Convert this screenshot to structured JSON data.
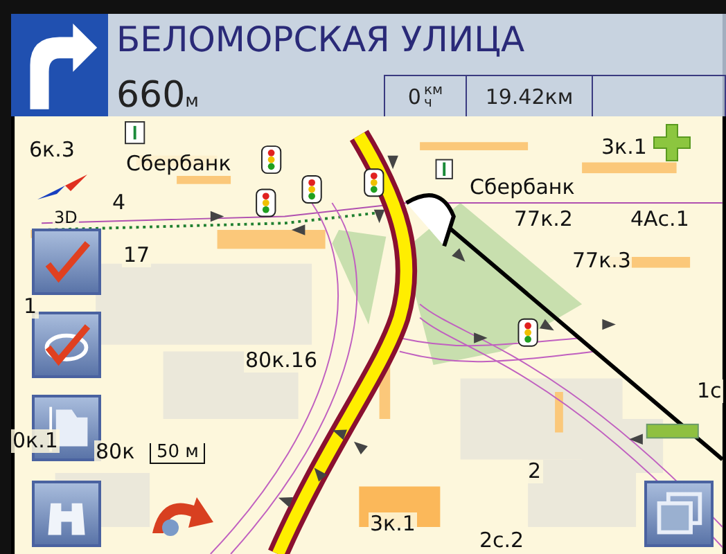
{
  "header": {
    "street": "БЕЛОМОРСКАЯ УЛИЦА",
    "distance": "660",
    "distance_unit": "м",
    "speed": "0",
    "speed_unit_top": "км",
    "speed_unit_bottom": "ч",
    "trip": "19.42км"
  },
  "map": {
    "view_mode": "3D",
    "scale": "50 м",
    "labels": [
      {
        "text": "6к.3"
      },
      {
        "text": "Сбербанк"
      },
      {
        "text": "Сбербанк"
      },
      {
        "text": "3к.1"
      },
      {
        "text": "4"
      },
      {
        "text": "77к.2"
      },
      {
        "text": "4Ас.1"
      },
      {
        "text": "77к.3"
      },
      {
        "text": "17"
      },
      {
        "text": "1"
      },
      {
        "text": "80к.16"
      },
      {
        "text": "0к.1"
      },
      {
        "text": "80к"
      },
      {
        "text": "2"
      },
      {
        "text": "3к.1"
      },
      {
        "text": "2с.2"
      },
      {
        "text": "1с"
      }
    ]
  }
}
